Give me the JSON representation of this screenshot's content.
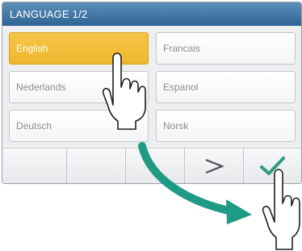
{
  "title_bar": {
    "text": "LANGUAGE  1/2"
  },
  "languages": [
    {
      "label": "English",
      "selected": true
    },
    {
      "label": "Francais",
      "selected": false
    },
    {
      "label": "Nederlands",
      "selected": false
    },
    {
      "label": "Espanol",
      "selected": false
    },
    {
      "label": "Deutsch",
      "selected": false
    },
    {
      "label": "Norsk",
      "selected": false
    }
  ],
  "bottom_bar": {
    "next_icon": "chevron-right-icon",
    "confirm_icon": "checkmark-icon"
  },
  "colors": {
    "title_bar": "#3a6fa0",
    "selected": "#f2bd3a",
    "confirm_check": "#2a9d80",
    "arrow": "#1f9a84"
  }
}
